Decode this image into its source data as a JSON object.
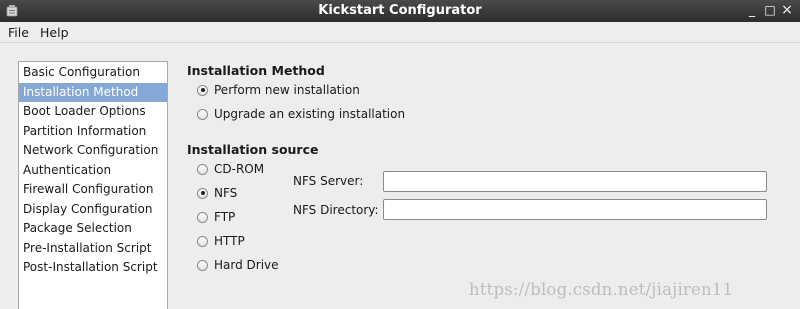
{
  "window": {
    "title": "Kickstart Configurator",
    "controls": {
      "minimize": "_",
      "maximize": "□",
      "close": "×"
    }
  },
  "menubar": {
    "items": [
      "File",
      "Help"
    ]
  },
  "sidebar": {
    "items": [
      {
        "label": "Basic Configuration",
        "selected": false
      },
      {
        "label": "Installation Method",
        "selected": true
      },
      {
        "label": "Boot Loader Options",
        "selected": false
      },
      {
        "label": "Partition Information",
        "selected": false
      },
      {
        "label": "Network Configuration",
        "selected": false
      },
      {
        "label": "Authentication",
        "selected": false
      },
      {
        "label": "Firewall Configuration",
        "selected": false
      },
      {
        "label": "Display Configuration",
        "selected": false
      },
      {
        "label": "Package Selection",
        "selected": false
      },
      {
        "label": "Pre-Installation Script",
        "selected": false
      },
      {
        "label": "Post-Installation Script",
        "selected": false
      }
    ]
  },
  "installation_method": {
    "title": "Installation Method",
    "options": [
      {
        "label": "Perform new installation",
        "checked": true
      },
      {
        "label": "Upgrade an existing installation",
        "checked": false
      }
    ]
  },
  "installation_source": {
    "title": "Installation source",
    "options": [
      {
        "label": "CD-ROM",
        "checked": false
      },
      {
        "label": "NFS",
        "checked": true
      },
      {
        "label": "FTP",
        "checked": false
      },
      {
        "label": "HTTP",
        "checked": false
      },
      {
        "label": "Hard Drive",
        "checked": false
      }
    ],
    "nfs_server": {
      "label": "NFS Server:",
      "value": ""
    },
    "nfs_directory": {
      "label": "NFS Directory:",
      "value": ""
    }
  },
  "watermark": "https://blog.csdn.net/jiajiren11",
  "colors": {
    "titlebar": "#333333",
    "selection": "#86a8d6",
    "window_bg": "#ededed"
  }
}
